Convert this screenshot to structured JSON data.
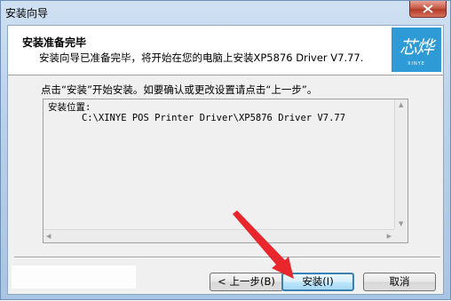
{
  "window": {
    "title": "安装向导"
  },
  "header": {
    "title": "安装准备完毕",
    "subtitle": "安装向导已准备完毕，将开始在您的电脑上安装XP5876 Driver V7.77.",
    "logo_text": "芯烨",
    "logo_subtext": "XINYE"
  },
  "instruction": "点击“安装”开始安装。如要确认或更改设置请点击“上一步”。",
  "info": {
    "label": "安装位置:",
    "path": "C:\\XINYE POS Printer Driver\\XP5876 Driver V7.77"
  },
  "buttons": {
    "back": "< 上一步(B)",
    "install": "安装(I)",
    "cancel": "取消"
  },
  "colors": {
    "logo_bg": "#2e9bd6",
    "arrow": "#e8262b"
  }
}
